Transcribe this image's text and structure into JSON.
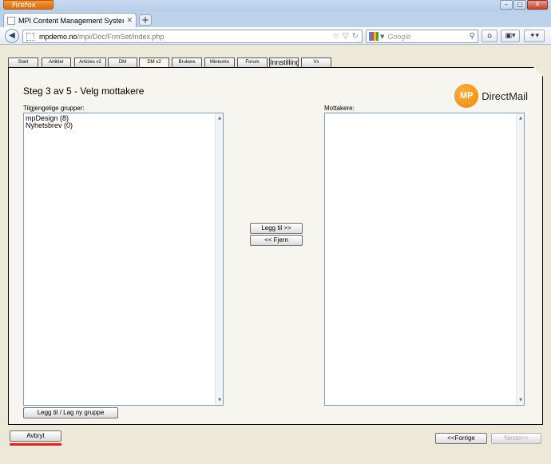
{
  "browser": {
    "menu_label": "Firefox",
    "tab_title": "MPI Content Management System v2.0....",
    "url_domain": "mpdemo.no",
    "url_path": "/mpi/Doc/FrmSet/index.php",
    "search_placeholder": "Google"
  },
  "app_tabs": [
    {
      "label": "Start"
    },
    {
      "label": "Artikler"
    },
    {
      "label": "Articles v2"
    },
    {
      "label": "DM"
    },
    {
      "label": "DM v2"
    },
    {
      "label": "Brukere"
    },
    {
      "label": "Minkonto"
    },
    {
      "label": "Forum"
    },
    {
      "label": "Innstilling"
    },
    {
      "label": "Vs"
    }
  ],
  "active_tab": "DM v2",
  "wizard": {
    "step_title": "Steg 3 av 5 - Velg mottakere",
    "logo_text": "DirectMail",
    "logo_mark": "MP"
  },
  "available_groups": {
    "label": "Tilgjengelige grupper:",
    "items": [
      "mpDesign (8)",
      "Nyhetsbrev (0)"
    ]
  },
  "recipients": {
    "label": "Mottakere:",
    "items": []
  },
  "buttons": {
    "add": "Legg til >>",
    "remove": "<< Fjern",
    "add_new_group": "Legg til / Lag ny gruppe",
    "cancel": "Avbryt",
    "previous": "<<Forrige",
    "next": "Neste>>"
  },
  "colors": {
    "highlight_underline": "#e02020",
    "logo_orange": "#f29a1f"
  }
}
